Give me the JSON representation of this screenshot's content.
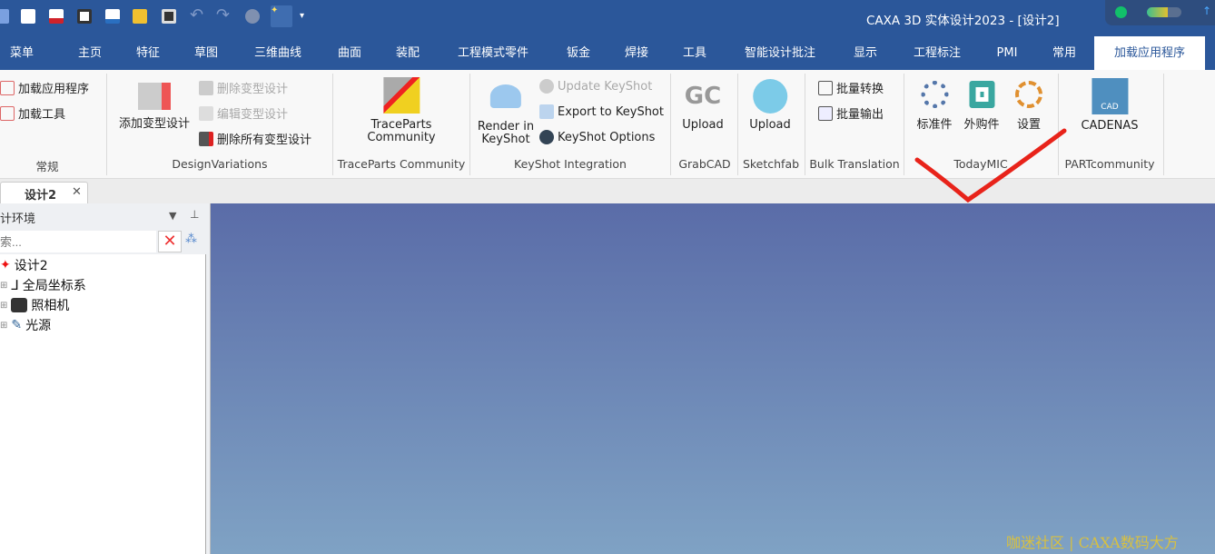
{
  "title": "CAXA 3D 实体设计2023 - [设计2]",
  "quick_access": [
    "app-logo-icon",
    "new-icon",
    "open-icon",
    "print-preview-icon",
    "mail-icon",
    "folder-icon",
    "save-icon",
    "undo-icon",
    "redo-icon",
    "render-icon",
    "design-icon",
    "customize-dropdown-icon"
  ],
  "tabs": [
    "菜单",
    "主页",
    "特征",
    "草图",
    "三维曲线",
    "曲面",
    "装配",
    "工程模式零件",
    "钣金",
    "焊接",
    "工具",
    "智能设计批注",
    "显示",
    "工程标注",
    "PMI",
    "常用",
    "加载应用程序"
  ],
  "active_tab": "加载应用程序",
  "ribbon": {
    "general": {
      "label": "常规",
      "load_app": "加载应用程序",
      "load_tool": "加载工具"
    },
    "design_variations": {
      "label": "DesignVariations",
      "add": "添加变型设计",
      "delete": "删除变型设计",
      "edit": "编辑变型设计",
      "delete_all": "删除所有变型设计"
    },
    "traceparts": {
      "label": "TraceParts Community",
      "button_line1": "TraceParts",
      "button_line2": "Community"
    },
    "keyshot": {
      "label": "KeyShot Integration",
      "render_line1": "Render in",
      "render_line2": "KeyShot",
      "update": "Update KeyShot",
      "export": "Export to KeyShot",
      "options": "KeyShot Options"
    },
    "grabcad": {
      "label": "GrabCAD",
      "upload": "Upload",
      "logo": "GC"
    },
    "sketchfab": {
      "label": "Sketchfab",
      "upload": "Upload"
    },
    "bulk": {
      "label": "Bulk Translation",
      "convert": "批量转换",
      "output": "批量输出"
    },
    "todaymic": {
      "label": "TodayMIC",
      "standard": "标准件",
      "purchased": "外购件",
      "settings": "设置"
    },
    "partcommunity": {
      "label": "PARTcommunity",
      "cadenas": "CADENAS",
      "logo": "CAD"
    }
  },
  "doc_tab": {
    "label": "设计2",
    "close": "✕"
  },
  "panel": {
    "title": "计环境",
    "search_placeholder": "索...",
    "tree": [
      {
        "label": "设计2"
      },
      {
        "label": "全局坐标系"
      },
      {
        "label": "照相机"
      },
      {
        "label": "光源"
      }
    ]
  },
  "watermark": "咖迷社区 | CAXA数码大方",
  "colors": {
    "titlebar": "#2b579a",
    "annotation": "#e8231a"
  }
}
